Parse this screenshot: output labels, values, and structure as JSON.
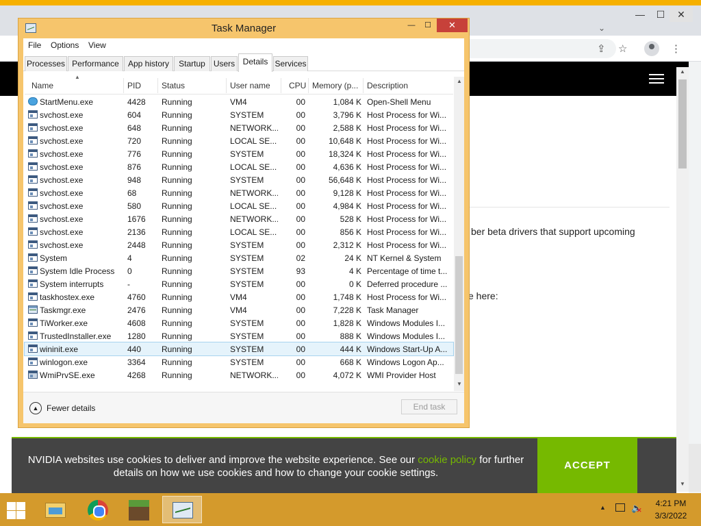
{
  "colors": {
    "accent_nvidia": "#76b900",
    "close_red": "#c7413a",
    "window_frame": "#f6c56c",
    "taskbar": "#d49a2c"
  },
  "browser": {
    "controls": {
      "minimize": "—",
      "maximize": "☐",
      "close": "✕",
      "tab_search": "⌄"
    },
    "icons": [
      "share-icon",
      "star-icon",
      "profile-icon",
      "menu-icon"
    ],
    "page_text_1": "ber beta drivers that support upcoming",
    "page_text_2": "e here:"
  },
  "cookie": {
    "text_before": "NVIDIA websites use cookies to deliver and improve the website experience. See our ",
    "link": "cookie policy",
    "text_after": " for further details on how we use cookies and how to change your cookie settings.",
    "accept": "ACCEPT"
  },
  "task_manager": {
    "title": "Task Manager",
    "controls": {
      "minimize": "—",
      "maximize": "☐",
      "close": "✕"
    },
    "menu": [
      "File",
      "Options",
      "View"
    ],
    "tabs": [
      "Processes",
      "Performance",
      "App history",
      "Startup",
      "Users",
      "Details",
      "Services"
    ],
    "active_tab": "Details",
    "columns": [
      "Name",
      "PID",
      "Status",
      "User name",
      "CPU",
      "Memory (p...",
      "Description"
    ],
    "sorted_by": "Name",
    "rows": [
      {
        "icon": "globe",
        "name": "StartMenu.exe",
        "pid": "4428",
        "status": "Running",
        "user": "VM4",
        "cpu": "00",
        "mem": "1,084 K",
        "desc": "Open-Shell Menu"
      },
      {
        "icon": "win",
        "name": "svchost.exe",
        "pid": "604",
        "status": "Running",
        "user": "SYSTEM",
        "cpu": "00",
        "mem": "3,796 K",
        "desc": "Host Process for Wi..."
      },
      {
        "icon": "win",
        "name": "svchost.exe",
        "pid": "648",
        "status": "Running",
        "user": "NETWORK...",
        "cpu": "00",
        "mem": "2,588 K",
        "desc": "Host Process for Wi..."
      },
      {
        "icon": "win",
        "name": "svchost.exe",
        "pid": "720",
        "status": "Running",
        "user": "LOCAL SE...",
        "cpu": "00",
        "mem": "10,648 K",
        "desc": "Host Process for Wi..."
      },
      {
        "icon": "win",
        "name": "svchost.exe",
        "pid": "776",
        "status": "Running",
        "user": "SYSTEM",
        "cpu": "00",
        "mem": "18,324 K",
        "desc": "Host Process for Wi..."
      },
      {
        "icon": "win",
        "name": "svchost.exe",
        "pid": "876",
        "status": "Running",
        "user": "LOCAL SE...",
        "cpu": "00",
        "mem": "4,636 K",
        "desc": "Host Process for Wi..."
      },
      {
        "icon": "win",
        "name": "svchost.exe",
        "pid": "948",
        "status": "Running",
        "user": "SYSTEM",
        "cpu": "00",
        "mem": "56,648 K",
        "desc": "Host Process for Wi..."
      },
      {
        "icon": "win",
        "name": "svchost.exe",
        "pid": "68",
        "status": "Running",
        "user": "NETWORK...",
        "cpu": "00",
        "mem": "9,128 K",
        "desc": "Host Process for Wi..."
      },
      {
        "icon": "win",
        "name": "svchost.exe",
        "pid": "580",
        "status": "Running",
        "user": "LOCAL SE...",
        "cpu": "00",
        "mem": "4,984 K",
        "desc": "Host Process for Wi..."
      },
      {
        "icon": "win",
        "name": "svchost.exe",
        "pid": "1676",
        "status": "Running",
        "user": "NETWORK...",
        "cpu": "00",
        "mem": "528 K",
        "desc": "Host Process for Wi..."
      },
      {
        "icon": "win",
        "name": "svchost.exe",
        "pid": "2136",
        "status": "Running",
        "user": "LOCAL SE...",
        "cpu": "00",
        "mem": "856 K",
        "desc": "Host Process for Wi..."
      },
      {
        "icon": "win",
        "name": "svchost.exe",
        "pid": "2448",
        "status": "Running",
        "user": "SYSTEM",
        "cpu": "00",
        "mem": "2,312 K",
        "desc": "Host Process for Wi..."
      },
      {
        "icon": "win",
        "name": "System",
        "pid": "4",
        "status": "Running",
        "user": "SYSTEM",
        "cpu": "02",
        "mem": "24 K",
        "desc": "NT Kernel & System"
      },
      {
        "icon": "win",
        "name": "System Idle Process",
        "pid": "0",
        "status": "Running",
        "user": "SYSTEM",
        "cpu": "93",
        "mem": "4 K",
        "desc": "Percentage of time t..."
      },
      {
        "icon": "win",
        "name": "System interrupts",
        "pid": "-",
        "status": "Running",
        "user": "SYSTEM",
        "cpu": "00",
        "mem": "0 K",
        "desc": "Deferred procedure ..."
      },
      {
        "icon": "win",
        "name": "taskhostex.exe",
        "pid": "4760",
        "status": "Running",
        "user": "VM4",
        "cpu": "00",
        "mem": "1,748 K",
        "desc": "Host Process for Wi..."
      },
      {
        "icon": "chart",
        "name": "Taskmgr.exe",
        "pid": "2476",
        "status": "Running",
        "user": "VM4",
        "cpu": "00",
        "mem": "7,228 K",
        "desc": "Task Manager"
      },
      {
        "icon": "win",
        "name": "TiWorker.exe",
        "pid": "4608",
        "status": "Running",
        "user": "SYSTEM",
        "cpu": "00",
        "mem": "1,828 K",
        "desc": "Windows Modules I..."
      },
      {
        "icon": "win",
        "name": "TrustedInstaller.exe",
        "pid": "1280",
        "status": "Running",
        "user": "SYSTEM",
        "cpu": "00",
        "mem": "888 K",
        "desc": "Windows Modules I..."
      },
      {
        "icon": "win",
        "name": "wininit.exe",
        "pid": "440",
        "status": "Running",
        "user": "SYSTEM",
        "cpu": "00",
        "mem": "444 K",
        "desc": "Windows Start-Up A...",
        "selected": true
      },
      {
        "icon": "win",
        "name": "winlogon.exe",
        "pid": "3364",
        "status": "Running",
        "user": "SYSTEM",
        "cpu": "00",
        "mem": "668 K",
        "desc": "Windows Logon Ap..."
      },
      {
        "icon": "gear",
        "name": "WmiPrvSE.exe",
        "pid": "4268",
        "status": "Running",
        "user": "NETWORK...",
        "cpu": "00",
        "mem": "4,072 K",
        "desc": "WMI Provider Host"
      }
    ],
    "fewer_details": "Fewer details",
    "end_task": "End task"
  },
  "taskbar": {
    "apps": [
      "file-explorer",
      "google-chrome",
      "minecraft",
      "task-manager"
    ],
    "active_app": "task-manager",
    "tray": {
      "time": "4:21 PM",
      "date": "3/3/2022"
    }
  }
}
